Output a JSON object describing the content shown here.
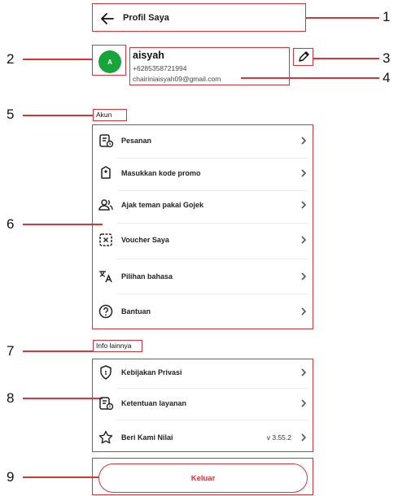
{
  "header": {
    "title": "Profil Saya"
  },
  "profile": {
    "avatar_initial": "A",
    "name": "aisyah",
    "phone": "+6285358721994",
    "email": "chairiniaisyah09@gmail.com"
  },
  "sections": {
    "account_label": "Akun",
    "other_label": "Info lainnya"
  },
  "account_items": [
    {
      "label": "Pesanan",
      "icon": "order-list-icon"
    },
    {
      "label": "Masukkan kode promo",
      "icon": "promo-tag-icon"
    },
    {
      "label": "Ajak teman pakai Gojek",
      "icon": "invite-friends-icon"
    },
    {
      "label": "Voucher Saya",
      "icon": "voucher-icon"
    },
    {
      "label": "Pilihan bahasa",
      "icon": "language-icon"
    },
    {
      "label": "Bantuan",
      "icon": "help-icon"
    }
  ],
  "other_items": [
    {
      "label": "Kebijakan Privasi",
      "icon": "privacy-shield-icon"
    },
    {
      "label": "Ketentuan layanan",
      "icon": "terms-icon"
    },
    {
      "label": "Beri Kami Nilai",
      "icon": "star-icon",
      "extra": "v 3.55.2"
    }
  ],
  "logout": {
    "label": "Keluar"
  },
  "callouts": [
    "1",
    "2",
    "3",
    "4",
    "5",
    "6",
    "7",
    "8",
    "9"
  ],
  "colors": {
    "annotation": "#d9343a",
    "avatar": "#17a43b",
    "logout": "#d9343a"
  }
}
